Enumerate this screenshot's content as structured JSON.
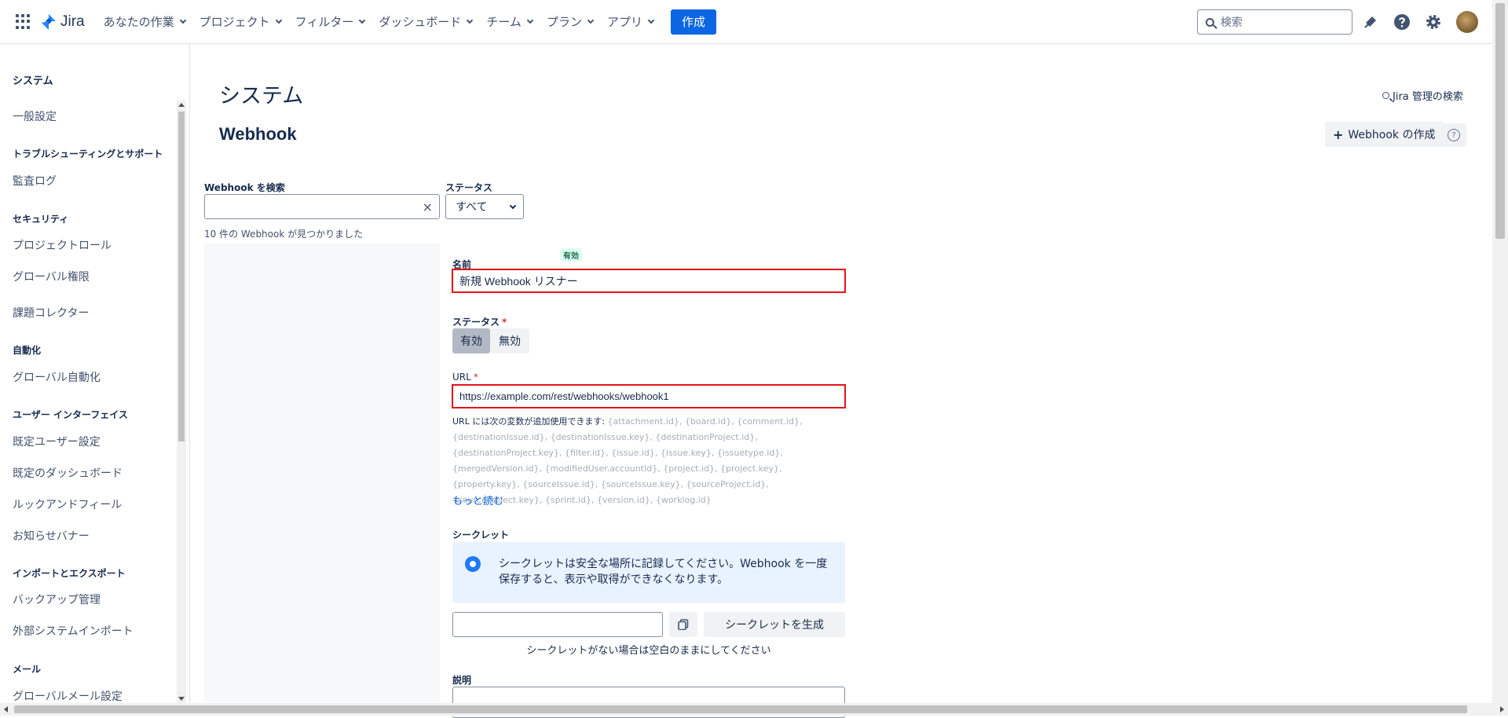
{
  "nav": {
    "logo_text": "Jira",
    "items": [
      "あなたの作業",
      "プロジェクト",
      "フィルター",
      "ダッシュボード",
      "チーム",
      "プラン",
      "アプリ"
    ],
    "create_label": "作成",
    "search_placeholder": "検索"
  },
  "sidebar": {
    "title": "システム",
    "entries": [
      {
        "type": "link",
        "label": "一般設定"
      },
      {
        "type": "section",
        "label": "トラブルシューティングとサポート"
      },
      {
        "type": "link",
        "label": "監査ログ"
      },
      {
        "type": "section",
        "label": "セキュリティ"
      },
      {
        "type": "link",
        "label": "プロジェクトロール"
      },
      {
        "type": "link",
        "label": "グローバル権限"
      },
      {
        "type": "link",
        "label": "課題コレクター"
      },
      {
        "type": "section",
        "label": "自動化"
      },
      {
        "type": "link",
        "label": "グローバル自動化"
      },
      {
        "type": "section",
        "label": "ユーザー インターフェイス"
      },
      {
        "type": "link",
        "label": "既定ユーザー設定"
      },
      {
        "type": "link",
        "label": "既定のダッシュボード"
      },
      {
        "type": "link",
        "label": "ルックアンドフィール"
      },
      {
        "type": "link",
        "label": "お知らせバナー"
      },
      {
        "type": "section",
        "label": "インポートとエクスポート"
      },
      {
        "type": "link",
        "label": "バックアップ管理"
      },
      {
        "type": "link",
        "label": "外部システムインポート"
      },
      {
        "type": "section",
        "label": "メール"
      },
      {
        "type": "link",
        "label": "グローバルメール設定"
      }
    ]
  },
  "main": {
    "page_title": "システム",
    "section_title": "Webhook",
    "admin_search": "Jira 管理の検索",
    "create_webhook_label": "Webhook の作成",
    "help_symbol": "?",
    "search_label": "Webhook を検索",
    "search_value": "",
    "status_label": "ステータス",
    "status_value": "すべて",
    "count_text": "10 件の Webhook が見つかりました"
  },
  "form": {
    "enabled_badge": "有効",
    "name_label": "名前",
    "name_value": "新規 Webhook リスナー",
    "status_label": "ステータス",
    "status_options": [
      "有効",
      "無効"
    ],
    "status_selected": "有効",
    "url_label": "URL",
    "url_value": "https://example.com/rest/webhooks/webhook1",
    "url_hint_lead": "URL には次の変数が追加使用できます:",
    "url_hint_vars": "{attachment.id}, {board.id}, {comment.id}, {destinationIssue.id}, {destinationIssue.key}, {destinationProject.id}, {destinationProject.key}, {filter.id}, {issue.id}, {issue.key}, {issuetype.id}, {mergedVersion.id}, {modifiedUser.accountId}, {project.id}, {project.key}, {property.key}, {sourceIssue.id}, {sourceIssue.key}, {sourceProject.id}, {sourceProject.key}, {sprint.id}, {version.id}, {worklog.id}",
    "more_link": "もっと読む",
    "secret_label": "シークレット",
    "secret_info": "シークレットは安全な場所に記録してください。Webhook を一度保存すると、表示や取得ができなくなります。",
    "secret_value": "",
    "generate_label": "シークレットを生成",
    "secret_help": "シークレットがない場合は空白のままにしてください",
    "description_label": "説明"
  },
  "colors": {
    "brand_blue": "#0c66e4",
    "error_red": "#e2121a",
    "info_bg": "#e9f2ff",
    "success_bg": "#dcfff1"
  }
}
